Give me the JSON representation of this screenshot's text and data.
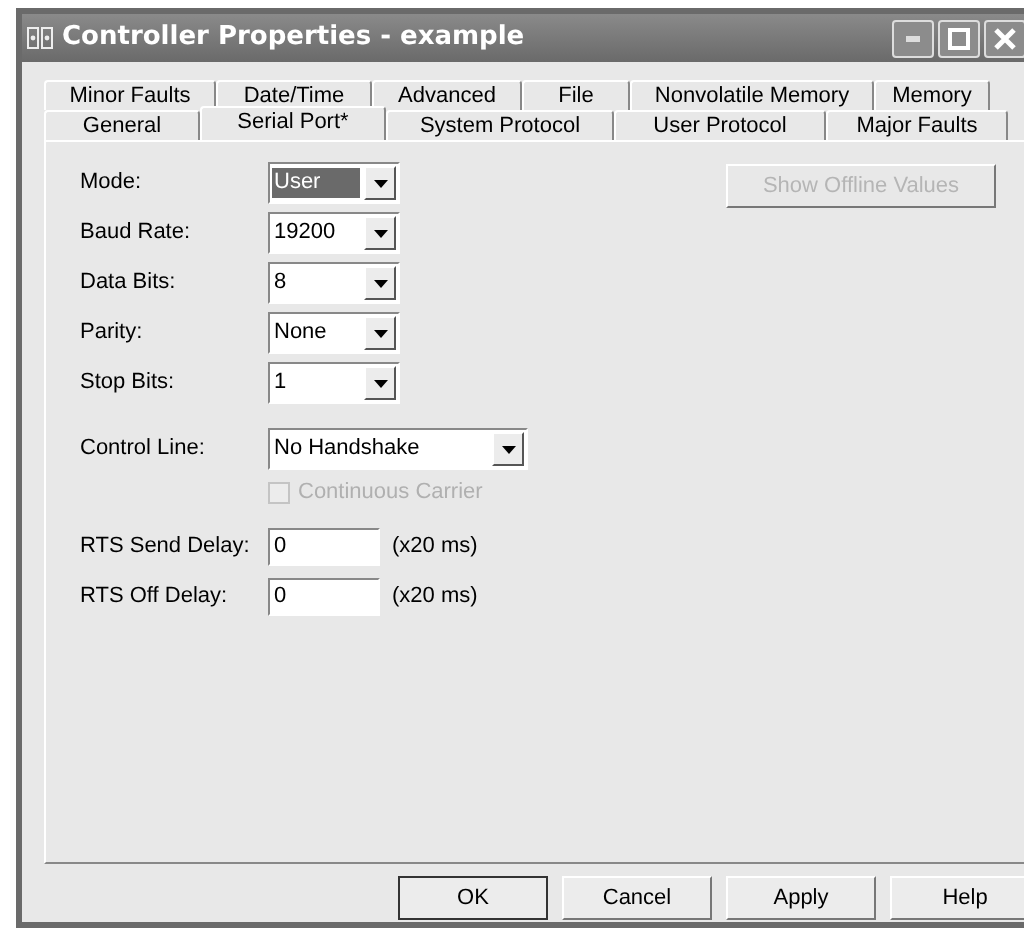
{
  "window": {
    "title": "Controller Properties - example"
  },
  "tab_rows": [
    [
      {
        "label": "Minor Faults",
        "selected": false
      },
      {
        "label": "Date/Time",
        "selected": false
      },
      {
        "label": "Advanced",
        "selected": false
      },
      {
        "label": "File",
        "selected": false
      },
      {
        "label": "Nonvolatile Memory",
        "selected": false
      },
      {
        "label": "Memory",
        "selected": false
      }
    ],
    [
      {
        "label": "General",
        "selected": false
      },
      {
        "label": "Serial Port*",
        "selected": true
      },
      {
        "label": "System Protocol",
        "selected": false
      },
      {
        "label": "User Protocol",
        "selected": false
      },
      {
        "label": "Major Faults",
        "selected": false
      }
    ]
  ],
  "show_offline_button": {
    "label": "Show Offline Values",
    "disabled": true
  },
  "fields": [
    {
      "kind": "select",
      "label": "Mode:",
      "value": "User",
      "focused": true
    },
    {
      "kind": "select",
      "label": "Baud Rate:",
      "value": "19200",
      "focused": false
    },
    {
      "kind": "select",
      "label": "Data Bits:",
      "value": "8",
      "focused": false
    },
    {
      "kind": "select",
      "label": "Parity:",
      "value": "None",
      "focused": false
    },
    {
      "kind": "select",
      "label": "Stop Bits:",
      "value": "1",
      "focused": false
    },
    {
      "kind": "wide_select",
      "label": "Control Line:",
      "value": "No Handshake",
      "focused": false
    },
    {
      "kind": "checkbox",
      "label": "Continuous Carrier",
      "checked": false,
      "disabled": true
    },
    {
      "kind": "input",
      "label": "RTS Send Delay:",
      "value": "0",
      "unit": "(x20 ms)"
    },
    {
      "kind": "input",
      "label": "RTS Off Delay:",
      "value": "0",
      "unit": "(x20 ms)"
    }
  ],
  "buttons": [
    {
      "label": "OK",
      "default": true
    },
    {
      "label": "Cancel",
      "default": false
    },
    {
      "label": "Apply",
      "default": false
    },
    {
      "label": "Help",
      "default": false
    }
  ]
}
